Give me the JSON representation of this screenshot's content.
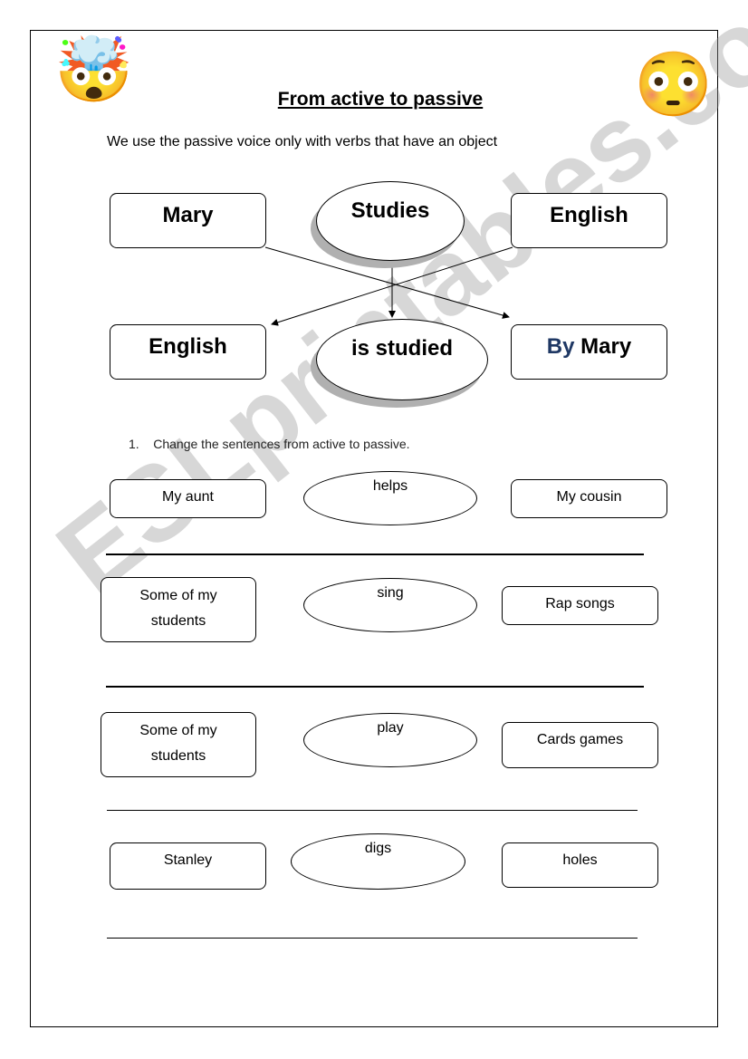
{
  "title": "From active to passive",
  "intro": "We use the passive voice only with verbs that have an object",
  "icons": {
    "left_emoji": "exploding-head-icon",
    "right_emoji": "flushed-face-icon",
    "left_glyph": "🤯",
    "right_glyph": "😳"
  },
  "example": {
    "active": {
      "subject": "Mary",
      "verb": "Studies",
      "object": "English"
    },
    "passive": {
      "subject": "English",
      "verb": "is studied",
      "agent_prefix": "By",
      "agent": "Mary"
    }
  },
  "instruction": {
    "number": "1.",
    "text": "Change the sentences from active to passive."
  },
  "exercises": [
    {
      "subject": "My aunt",
      "verb": "helps",
      "object": "My cousin"
    },
    {
      "subject_line1": "Some of my",
      "subject_line2": "students",
      "verb": "sing",
      "object": "Rap songs"
    },
    {
      "subject_line1": "Some of my",
      "subject_line2": "students",
      "verb": "play",
      "object": "Cards games"
    },
    {
      "subject": "Stanley",
      "verb": "digs",
      "object": "holes"
    }
  ],
  "watermark": "ESLprintables.com",
  "colors": {
    "agent_prefix": "#1f3864",
    "watermark": "#969696"
  }
}
